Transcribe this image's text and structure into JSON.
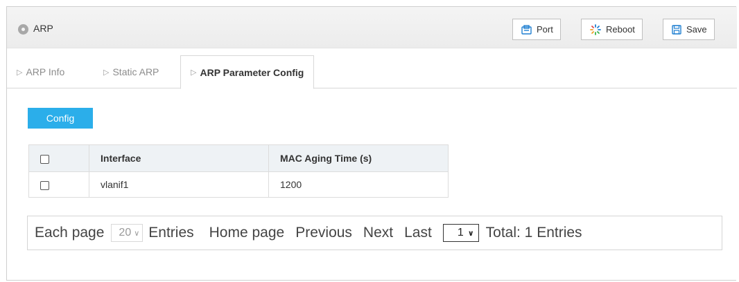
{
  "header": {
    "title": "ARP",
    "buttons": [
      {
        "label": "Port",
        "icon": "port-icon"
      },
      {
        "label": "Reboot",
        "icon": "reboot-icon"
      },
      {
        "label": "Save",
        "icon": "save-icon"
      }
    ]
  },
  "tabs": [
    {
      "label": "ARP Info",
      "active": false
    },
    {
      "label": "Static ARP",
      "active": false
    },
    {
      "label": "ARP Parameter Config",
      "active": true
    }
  ],
  "config_button": "Config",
  "table": {
    "columns": [
      "Interface",
      "MAC Aging Time (s)"
    ],
    "rows": [
      {
        "interface": "vlanif1",
        "mac_aging_time": "1200"
      }
    ]
  },
  "pager": {
    "each_page": "Each page",
    "page_size": "20",
    "entries": "Entries",
    "home": "Home page",
    "previous": "Previous",
    "next": "Next",
    "last": "Last",
    "current_page": "1",
    "total": "Total: 1 Entries"
  },
  "colors": {
    "accent": "#2baeea",
    "header_bg": "#efefef",
    "table_header_bg": "#eef2f5"
  }
}
